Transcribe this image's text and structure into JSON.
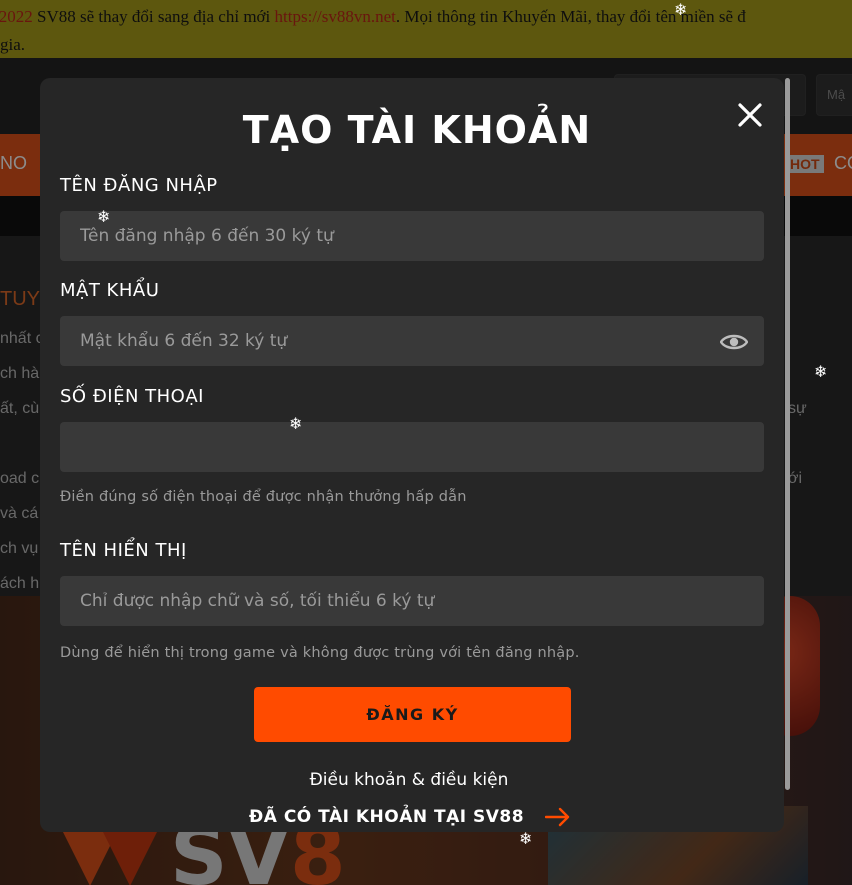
{
  "background": {
    "notice": {
      "date_fragment": "/2022",
      "text_before_link": " SV88 sẽ thay đổi sang địa chỉ mới ",
      "link": "https://sv88vn.net",
      "text_after_link": ". Mọi thông tin Khuyến Mãi, thay đổi tên miền sẽ đ",
      "line2": "gia."
    },
    "header_input_1": "",
    "header_input_2": "Mậ",
    "nav_left": "NO",
    "nav_hot_badge": "HOT",
    "nav_right": "CO",
    "content_title": "TUY",
    "content_lines": [
      "nhất c",
      "ch hà",
      "ất, cù",
      "oad c",
      "và cá",
      "ch vụ",
      "ách h"
    ],
    "content_lines_right": [
      "sự",
      "ới"
    ]
  },
  "modal": {
    "title": "TẠO TÀI KHOẢN",
    "username": {
      "label": "TÊN ĐĂNG NHẬP",
      "placeholder": "Tên đăng nhập 6 đến 30 ký tự",
      "value": ""
    },
    "password": {
      "label": "MẬT KHẨU",
      "placeholder": "Mật khẩu 6 đến 32 ký tự",
      "value": ""
    },
    "phone": {
      "label": "SỐ ĐIỆN THOẠI",
      "placeholder": "",
      "value": "",
      "hint": "Điền đúng số điện thoại để được nhận thưởng hấp dẫn"
    },
    "display_name": {
      "label": "TÊN HIỂN THỊ",
      "placeholder": "Chỉ được nhập chữ và số, tối thiểu 6 ký tự",
      "value": "",
      "hint": "Dùng để hiển thị trong game và không được trùng với tên đăng nhập."
    },
    "submit_label": "ĐĂNG KÝ",
    "terms_label": "Điều khoản & điều kiện",
    "login_label": "ĐÃ CÓ TÀI KHOẢN TẠI SV88"
  },
  "decor": {
    "snowflake": "❄"
  },
  "colors": {
    "accent": "#ff4b00",
    "modal_bg": "#262626",
    "input_bg": "#393939",
    "notice_bg": "#a99f1a"
  },
  "icons": [
    "close-icon",
    "eye-icon",
    "arrow-right-icon",
    "snowflake-icon"
  ]
}
